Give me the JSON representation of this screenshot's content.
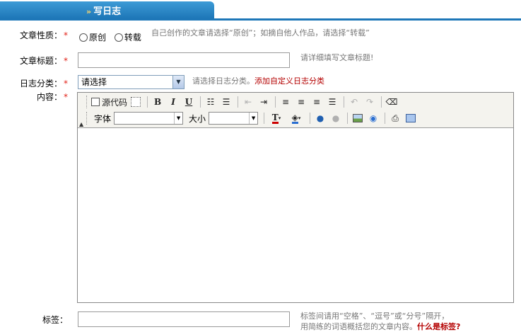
{
  "header": {
    "tab_title": "写日志"
  },
  "form": {
    "nature": {
      "label": "文章性质：",
      "options": [
        "原创",
        "转载"
      ],
      "hint": "自己创作的文章请选择“原创”；如摘自他人作品，请选择“转载”"
    },
    "title": {
      "label": "文章标题：",
      "value": "",
      "hint": "请详细填写文章标题!"
    },
    "category": {
      "label": "日志分类：",
      "selected": "请选择",
      "hint": "请选择日志分类。",
      "link": "添加自定义日志分类"
    },
    "content": {
      "label": "内容："
    },
    "tags": {
      "label": "标签：",
      "value": "",
      "hint_line1": "标签间请用“空格”、“逗号”或“分号”隔开，",
      "hint_line2": "用简练的词语概括您的文章内容。",
      "link": "什么是标签?"
    },
    "required_mark": "*"
  },
  "toolbar": {
    "source_label": "源代码",
    "bold": "B",
    "italic": "I",
    "underline": "U",
    "font_label": "字体",
    "size_label": "大小",
    "font_value": "",
    "size_value": ""
  }
}
